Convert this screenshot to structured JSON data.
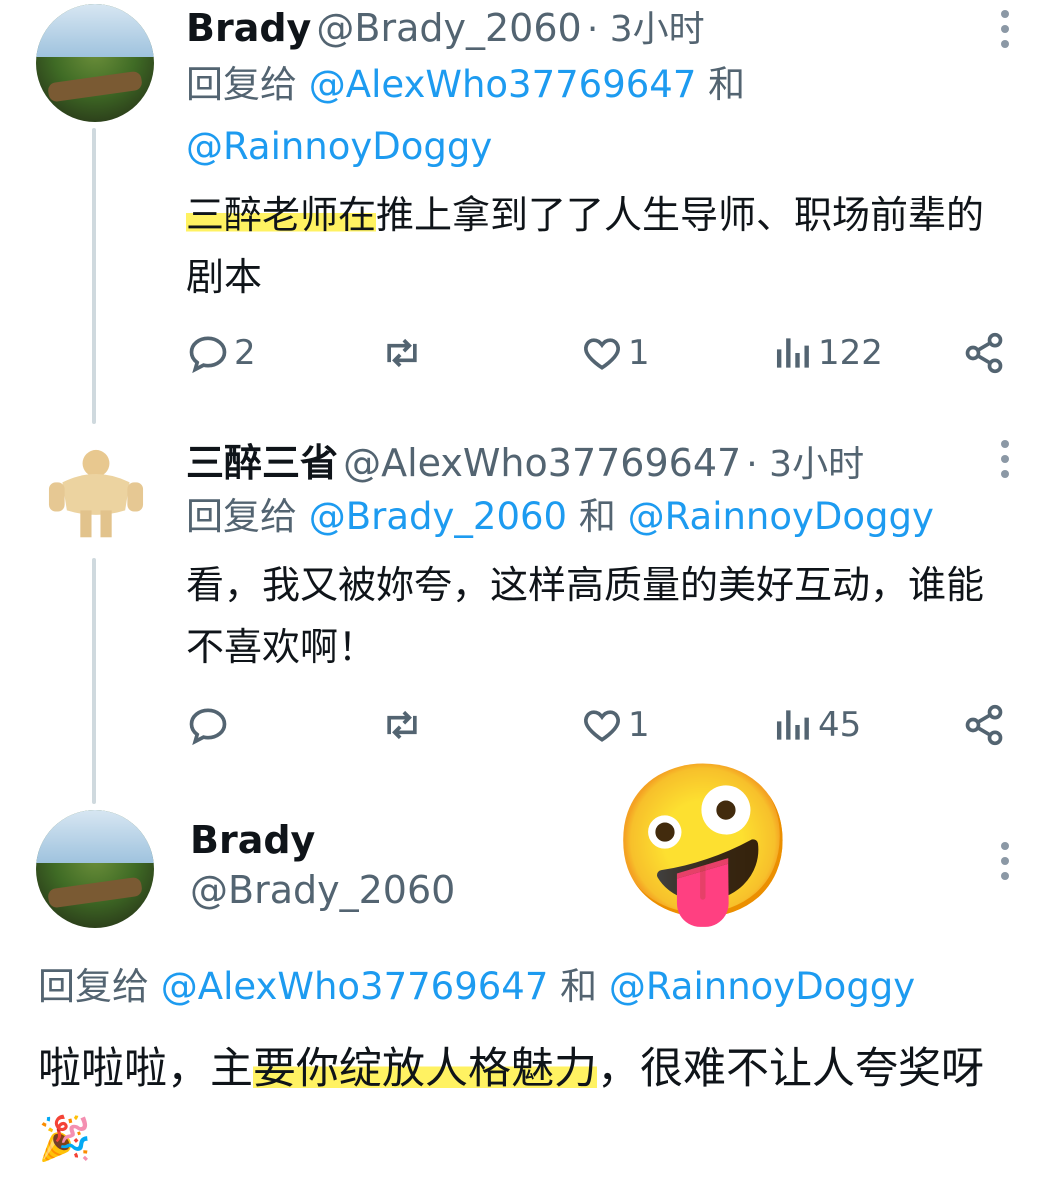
{
  "tweets": [
    {
      "name": "Brady",
      "handle": "@Brady_2060",
      "time": "· 3小时",
      "reply_prefix": "回复给",
      "mention1": "@AlexWho37769647",
      "and": "和",
      "mention2": "@RainnoyDoggy",
      "text_highlight": "三醉老师在",
      "text_rest": "推上拿到了了人生导师、职场前辈的剧本",
      "replies": "2",
      "retweets": "",
      "likes": "1",
      "views": "122"
    },
    {
      "name": "三醉三省",
      "handle": "@AlexWho37769647",
      "time": "· 3小时",
      "reply_prefix": "回复给",
      "mention1": "@Brady_2060",
      "and": "和",
      "mention2": "@RainnoyDoggy",
      "text": "看，我又被妳夸，这样高质量的美好互动，谁能不喜欢啊！",
      "replies": "",
      "retweets": "",
      "likes": "1",
      "views": "45"
    }
  ],
  "main_tweet": {
    "name": "Brady",
    "handle": "@Brady_2060",
    "reply_prefix": "回复给",
    "mention1": "@AlexWho37769647",
    "and": "和",
    "mention2": "@RainnoyDoggy",
    "text_a": "啦啦啦，主",
    "text_highlight": "要你绽放人格魅力",
    "text_b": "，很难不让人夸奖呀",
    "sticker": "🤪",
    "party_emoji": "🎉"
  },
  "icons": {
    "reply": "reply-icon",
    "retweet": "retweet-icon",
    "like": "heart-icon",
    "views": "views-icon",
    "share": "share-icon",
    "more": "more-icon"
  },
  "colors": {
    "link": "#1d9bf0",
    "secondary": "#536471",
    "highlight": "#fff046"
  }
}
